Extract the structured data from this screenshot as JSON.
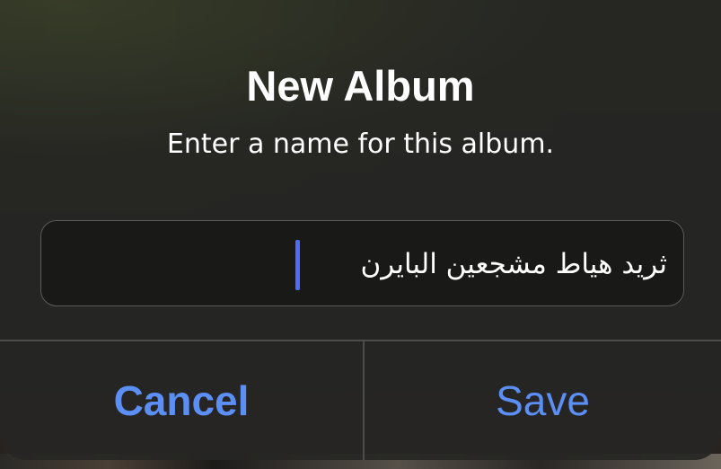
{
  "dialog": {
    "title": "New Album",
    "message": "Enter a name for this album.",
    "input_value": "ثريد هياط مشجعين البايرن",
    "cancel_label": "Cancel",
    "save_label": "Save"
  },
  "colors": {
    "accent": "#5b8ff5",
    "caret": "#4f6bff",
    "dialog_background": "#262624",
    "text": "#ffffff"
  }
}
